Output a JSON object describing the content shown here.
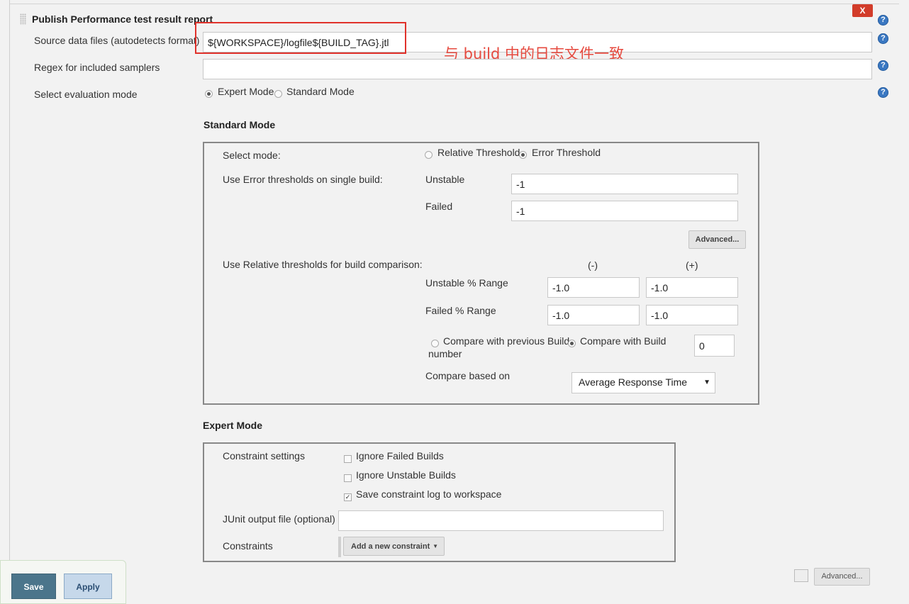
{
  "section": {
    "title": "Publish Performance test result report",
    "delete_label": "X",
    "help_glyph": "?"
  },
  "fields": {
    "source_label": "Source data files (autodetects format)",
    "source_value": "${WORKSPACE}/logfile${BUILD_TAG}.jtl",
    "regex_label": "Regex for included samplers",
    "regex_value": "",
    "eval_mode_label": "Select evaluation mode",
    "eval_options": [
      "Expert Mode",
      "Standard Mode"
    ],
    "eval_selected": "Expert Mode"
  },
  "annotation": {
    "text": "与 build 中的日志文件一致",
    "color": "#e64a3f"
  },
  "standard": {
    "heading": "Standard Mode",
    "select_mode_label": "Select mode:",
    "mode_options": [
      "Relative Threshold",
      "Error Threshold"
    ],
    "mode_selected": "Error Threshold",
    "error_thresholds_label": "Use Error thresholds on single build:",
    "unstable_label": "Unstable",
    "unstable_value": "-1",
    "failed_label": "Failed",
    "failed_value": "-1",
    "advanced_label": "Advanced...",
    "relative_label": "Use Relative thresholds for build comparison:",
    "minus_header": "(-)",
    "plus_header": "(+)",
    "unstable_range_label": "Unstable % Range",
    "unstable_range_minus": "-1.0",
    "unstable_range_plus": "-1.0",
    "failed_range_label": "Failed % Range",
    "failed_range_minus": "-1.0",
    "failed_range_plus": "-1.0",
    "compare_prev_label": "Compare with previous Build",
    "compare_build_label": "Compare with Build",
    "compare_build_label_cont": "number",
    "compare_selected": "Compare with Build number",
    "build_number_value": "0",
    "compare_based_label": "Compare based on",
    "compare_based_value": "Average Response Time"
  },
  "expert": {
    "heading": "Expert Mode",
    "constraint_settings_label": "Constraint settings",
    "ignore_failed_label": "Ignore Failed Builds",
    "ignore_failed_checked": false,
    "ignore_unstable_label": "Ignore Unstable Builds",
    "ignore_unstable_checked": false,
    "save_log_label": "Save constraint log to workspace",
    "save_log_checked": true,
    "junit_label": "JUnit output file (optional)",
    "junit_value": "",
    "constraints_label": "Constraints",
    "add_constraint_label": "Add a new constraint"
  },
  "footer": {
    "save_label": "Save",
    "apply_label": "Apply",
    "advanced_label": "Advanced..."
  },
  "colors": {
    "accent_blue": "#3a78c2",
    "delete_red": "#d23c2a",
    "highlight_red": "#e0322b",
    "save_button": "#4b758b",
    "apply_button": "#c6d8ea"
  }
}
